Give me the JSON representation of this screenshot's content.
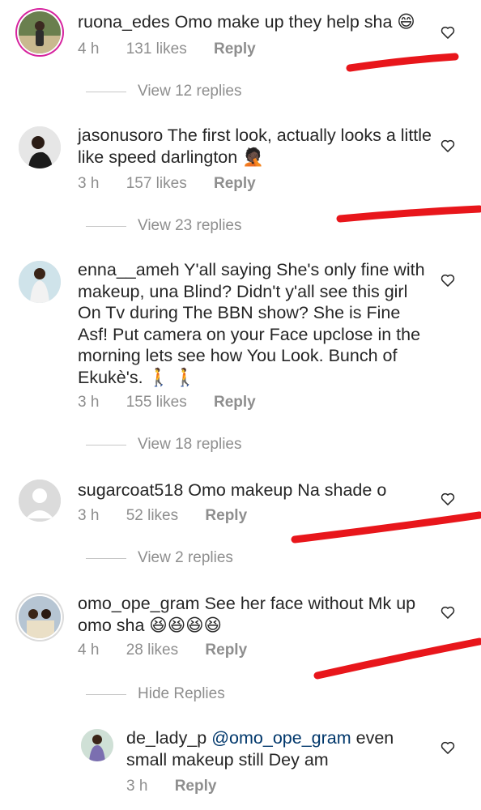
{
  "comments": [
    {
      "username": "ruona_edes",
      "text": "Omo make up they help sha 😄",
      "time": "4 h",
      "likes": "131 likes",
      "reply": "Reply",
      "view_replies": "View 12 replies"
    },
    {
      "username": "jasonusoro",
      "text": "The first look, actually looks a little like speed darlington 🤦🏿",
      "time": "3 h",
      "likes": "157 likes",
      "reply": "Reply",
      "view_replies": "View 23 replies"
    },
    {
      "username": "enna__ameh",
      "text": "Y'all saying She's only fine with makeup, una Blind?  Didn't y'all see this girl On Tv during The BBN show? She is Fine Asf!  Put camera on your Face upclose in the morning lets see how You Look.  Bunch of Ekukè's. 🚶 🚶",
      "time": "3 h",
      "likes": "155 likes",
      "reply": "Reply",
      "view_replies": "View 18 replies"
    },
    {
      "username": "sugarcoat518",
      "text": "Omo makeup Na shade o",
      "time": "3 h",
      "likes": "52 likes",
      "reply": "Reply",
      "view_replies": "View 2 replies"
    },
    {
      "username": "omo_ope_gram",
      "text": "See her face without Mk up omo sha 😆😆😆😆",
      "time": "4 h",
      "likes": "28 likes",
      "reply": "Reply",
      "view_replies": "Hide Replies"
    }
  ],
  "nested_reply": {
    "username": "de_lady_p",
    "mention": "@omo_ope_gram",
    "text": "even small makeup still Dey am",
    "time": "3 h",
    "reply": "Reply"
  },
  "colors": {
    "text": "#262626",
    "meta": "#8e8e8e",
    "annotation": "#e8161b",
    "mention": "#00376b"
  },
  "icons": [
    "heart-icon",
    "avatar"
  ]
}
